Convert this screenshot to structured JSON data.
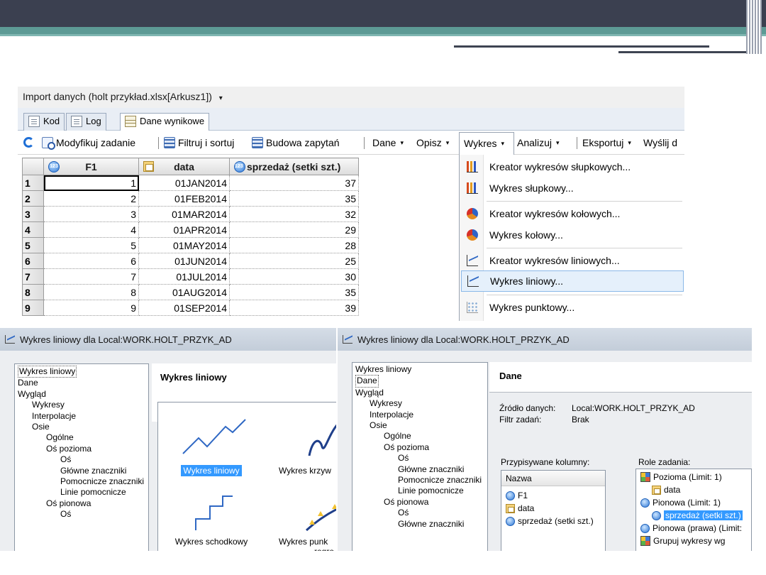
{
  "window": {
    "title": "Import danych (holt przykład.xlsx[Arkusz1])",
    "title_caret": "▾"
  },
  "tabs": [
    {
      "label": "Kod",
      "icon": "code-icon"
    },
    {
      "label": "Log",
      "icon": "log-icon"
    },
    {
      "label": "Dane wynikowe",
      "icon": "data-grid-icon",
      "active": true
    }
  ],
  "toolbar": {
    "refresh_icon": "refresh-icon",
    "modify": "Modyfikuj zadanie",
    "filter": "Filtruj i sortuj",
    "query": "Budowa zapytań",
    "data": "Dane",
    "describe": "Opisz",
    "chart": "Wykres",
    "analyze": "Analizuj",
    "export": "Eksportuj",
    "send": "Wyślij d",
    "caret": "▾"
  },
  "grid": {
    "columns": [
      {
        "label": "F1",
        "type": "numeric"
      },
      {
        "label": "data",
        "type": "date"
      },
      {
        "label": "sprzedaż (setki szt.)",
        "type": "numeric"
      }
    ],
    "rows": [
      {
        "n": "1",
        "f1": "1",
        "date": "01JAN2014",
        "val": "37"
      },
      {
        "n": "2",
        "f1": "2",
        "date": "01FEB2014",
        "val": "35"
      },
      {
        "n": "3",
        "f1": "3",
        "date": "01MAR2014",
        "val": "32"
      },
      {
        "n": "4",
        "f1": "4",
        "date": "01APR2014",
        "val": "29"
      },
      {
        "n": "5",
        "f1": "5",
        "date": "01MAY2014",
        "val": "28"
      },
      {
        "n": "6",
        "f1": "6",
        "date": "01JUN2014",
        "val": "25"
      },
      {
        "n": "7",
        "f1": "7",
        "date": "01JUL2014",
        "val": "30"
      },
      {
        "n": "8",
        "f1": "8",
        "date": "01AUG2014",
        "val": "35"
      },
      {
        "n": "9",
        "f1": "9",
        "date": "01SEP2014",
        "val": "39"
      }
    ]
  },
  "menu": {
    "items": [
      {
        "label": "Kreator wykresów słupkowych...",
        "icon": "bar-chart-icon"
      },
      {
        "label": "Wykres słupkowy...",
        "icon": "bar-chart-icon"
      },
      {
        "label": "Kreator wykresów kołowych...",
        "icon": "pie-chart-icon"
      },
      {
        "label": "Wykres kołowy...",
        "icon": "pie-chart-icon"
      },
      {
        "label": "Kreator wykresów liniowych...",
        "icon": "line-chart-icon"
      },
      {
        "label": "Wykres liniowy...",
        "icon": "line-chart-icon",
        "highlighted": true
      },
      {
        "label": "Wykres punktowy...",
        "icon": "scatter-chart-icon"
      }
    ]
  },
  "dialog1": {
    "title": "Wykres liniowy dla Local:WORK.HOLT_PRZYK_AD",
    "pane_title": "Wykres liniowy",
    "tree": [
      "Wykres liniowy",
      "Dane",
      "Wygląd",
      "Wykresy",
      "Interpolacje",
      "Osie",
      "Ogólne",
      "Oś pozioma",
      "Oś",
      "Główne znaczniki",
      "Pomocnicze znaczniki",
      "Linie pomocnicze",
      "Oś pionowa",
      "Oś"
    ],
    "gallery": [
      "Wykres liniowy",
      "Wykres krzyw",
      "Wykres schodkowy",
      "Wykres punk",
      "regre"
    ]
  },
  "dialog2": {
    "title": "Wykres liniowy dla Local:WORK.HOLT_PRZYK_AD",
    "pane_title": "Dane",
    "tree": [
      "Wykres liniowy",
      "Dane",
      "Wygląd",
      "Wykresy",
      "Interpolacje",
      "Osie",
      "Ogólne",
      "Oś pozioma",
      "Oś",
      "Główne znaczniki",
      "Pomocnicze znaczniki",
      "Linie pomocnicze",
      "Oś pionowa",
      "Oś",
      "Główne znaczniki"
    ],
    "source_label": "Źródło danych:",
    "source_value": "Local:WORK.HOLT_PRZYK_AD",
    "filter_label": "Filtr zadań:",
    "filter_value": "Brak",
    "columns_title": "Przypisywane kolumny:",
    "columns_header": "Nazwa",
    "columns": [
      "F1",
      "data",
      "sprzedaż (setki szt.)"
    ],
    "roles_title": "Role zadania:",
    "roles": [
      "Pozioma (Limit: 1)",
      "data",
      "Pionowa (Limit: 1)",
      "sprzedaż (setki szt.)",
      "Pionowa (prawa) (Limit:",
      "Grupuj wykresy wg"
    ]
  }
}
